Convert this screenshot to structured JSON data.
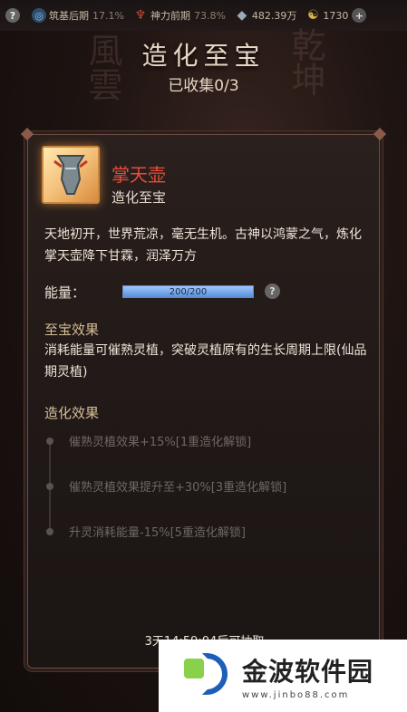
{
  "topbar": {
    "help_icon": "help-icon",
    "realm_label": "筑基后期",
    "realm_value": "17.1%",
    "power_label": "神力前期",
    "power_value": "73.8%",
    "stones": "482.39万",
    "coins": "1730"
  },
  "header": {
    "title": "造化至宝",
    "collected": "已收集0/3"
  },
  "item": {
    "icon": "teapot-icon",
    "name": "掌天壶",
    "type": "造化至宝",
    "description": "天地初开，世界荒凉，毫无生机。古神以鸿蒙之气，炼化掌天壶降下甘霖，润泽万方",
    "energy_label": "能量：",
    "energy_text": "200/200",
    "energy_fraction": 1.0
  },
  "treasure_effect": {
    "title": "至宝效果",
    "text": "消耗能量可催熟灵植，突破灵植原有的生长周期上限(仙品期灵植)"
  },
  "forge_effect": {
    "title": "造化效果",
    "items": [
      "催熟灵植效果+15%[1重造化解锁]",
      "催熟灵植效果提升至+30%[3重造化解锁]",
      "升灵消耗能量-15%[5重造化解锁]"
    ]
  },
  "footer": {
    "text": "3天14:59:04后可抽取"
  },
  "watermark": {
    "main": "金波软件园",
    "url": "www.jinbo88.com"
  },
  "colors": {
    "item_name": "#e84c3a",
    "section_title": "#d7bd98",
    "energy_bar": "#5c8fd8"
  }
}
